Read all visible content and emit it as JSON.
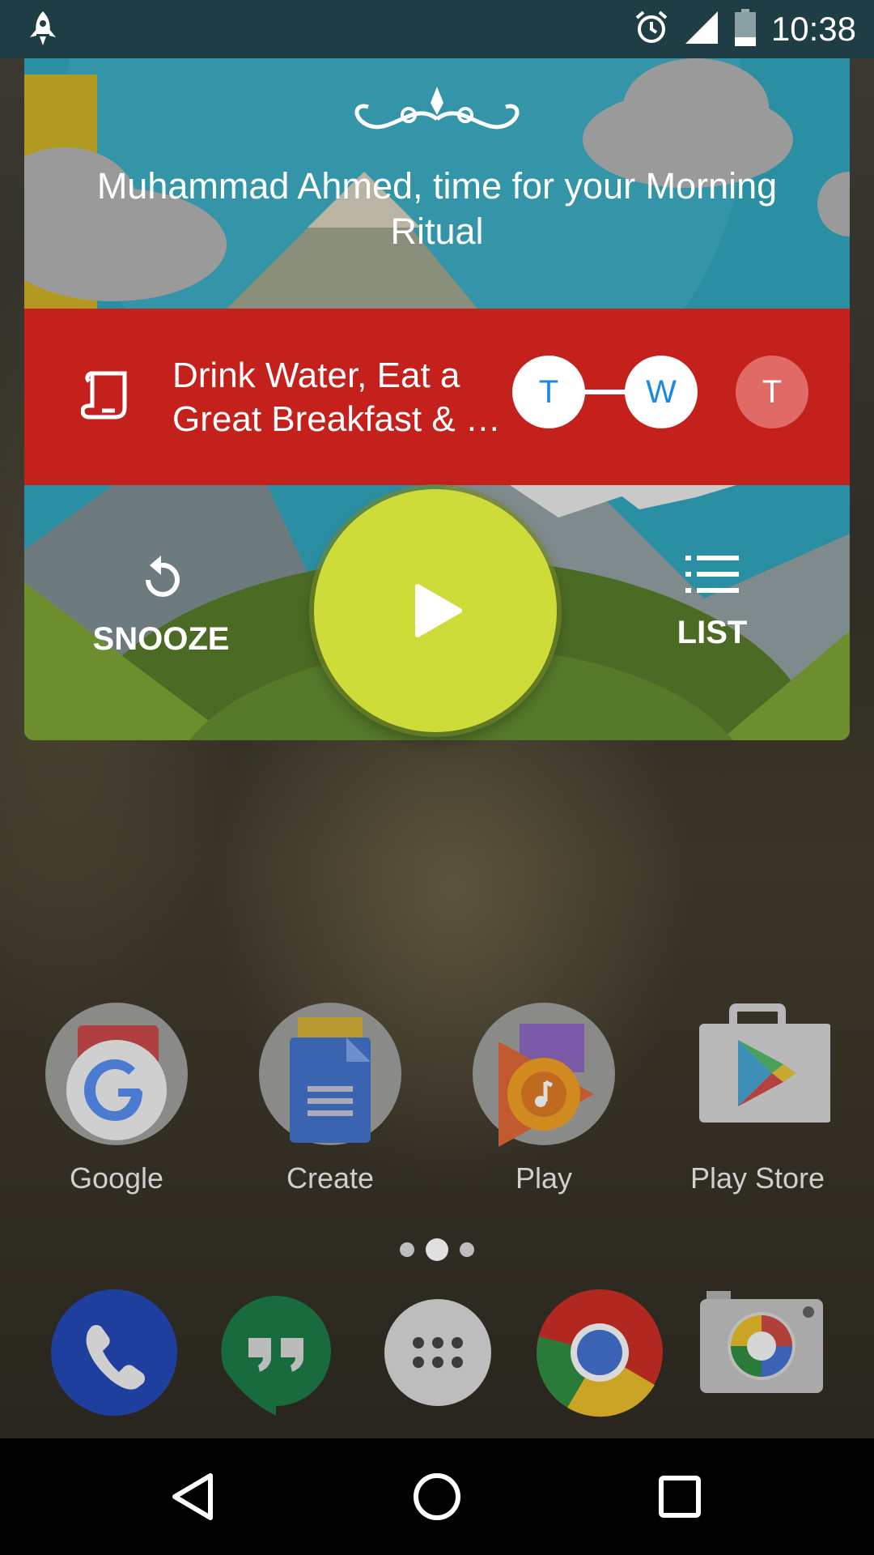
{
  "status_bar": {
    "time": "10:38",
    "icons": [
      "rocket-icon",
      "alarm-icon",
      "signal-icon",
      "battery-icon"
    ]
  },
  "ritual_card": {
    "title": "Muhammad Ahmed, time for your Morning Ritual",
    "habit_text": "Drink Water, Eat a\nGreat Breakfast & …",
    "habit_icon": "scroll-icon",
    "days": [
      {
        "letter": "T",
        "state": "done",
        "color": "#ffffff"
      },
      {
        "letter": "W",
        "state": "done",
        "color": "#ffffff"
      },
      {
        "letter": "T",
        "state": "pending",
        "color": "#e06a66"
      }
    ],
    "snooze_label": "SNOOZE",
    "list_label": "LIST",
    "play_icon": "play-icon",
    "colors": {
      "bar": "#c4201c",
      "play": "#cddc39",
      "sky": "#2a8fa3"
    }
  },
  "home_apps": [
    {
      "label": "Google",
      "icon": "google-folder-icon"
    },
    {
      "label": "Create",
      "icon": "docs-folder-icon"
    },
    {
      "label": "Play",
      "icon": "play-music-folder-icon"
    },
    {
      "label": "Play Store",
      "icon": "play-store-icon"
    }
  ],
  "page_indicator": {
    "pages": 3,
    "current": 2
  },
  "dock": [
    "phone-icon",
    "hangouts-icon",
    "app-drawer-icon",
    "chrome-icon",
    "camera-icon"
  ],
  "nav_bar": [
    "back-icon",
    "home-icon",
    "recents-icon"
  ]
}
